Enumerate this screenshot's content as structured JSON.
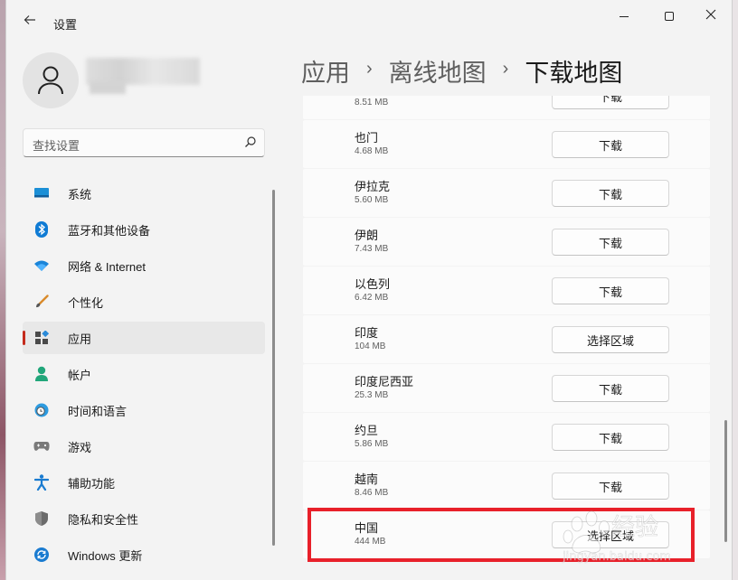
{
  "window": {
    "title": "设置"
  },
  "search": {
    "placeholder": "查找设置"
  },
  "nav": {
    "items": [
      {
        "label": "系统",
        "icon": "display-icon"
      },
      {
        "label": "蓝牙和其他设备",
        "icon": "bluetooth-icon"
      },
      {
        "label": "网络 & Internet",
        "icon": "wifi-icon"
      },
      {
        "label": "个性化",
        "icon": "brush-icon"
      },
      {
        "label": "应用",
        "icon": "apps-icon",
        "selected": true
      },
      {
        "label": "帐户",
        "icon": "person-icon"
      },
      {
        "label": "时间和语言",
        "icon": "globe-clock-icon"
      },
      {
        "label": "游戏",
        "icon": "gamepad-icon"
      },
      {
        "label": "辅助功能",
        "icon": "accessibility-icon"
      },
      {
        "label": "隐私和安全性",
        "icon": "shield-icon"
      },
      {
        "label": "Windows 更新",
        "icon": "update-icon"
      }
    ]
  },
  "breadcrumb": {
    "items": [
      "应用",
      "离线地图",
      "下载地图"
    ],
    "separator": "›"
  },
  "maps": [
    {
      "name": "",
      "size": "8.51 MB",
      "action": "下载"
    },
    {
      "name": "也门",
      "size": "4.68 MB",
      "action": "下载"
    },
    {
      "name": "伊拉克",
      "size": "5.60 MB",
      "action": "下载"
    },
    {
      "name": "伊朗",
      "size": "7.43 MB",
      "action": "下载"
    },
    {
      "name": "以色列",
      "size": "6.42 MB",
      "action": "下载"
    },
    {
      "name": "印度",
      "size": "104 MB",
      "action": "选择区域"
    },
    {
      "name": "印度尼西亚",
      "size": "25.3 MB",
      "action": "下载"
    },
    {
      "name": "约旦",
      "size": "5.86 MB",
      "action": "下载"
    },
    {
      "name": "越南",
      "size": "8.46 MB",
      "action": "下载"
    },
    {
      "name": "中国",
      "size": "444 MB",
      "action": "选择区域"
    }
  ],
  "colors": {
    "accent": "#c42b1c",
    "highlight": "#e8202a"
  }
}
